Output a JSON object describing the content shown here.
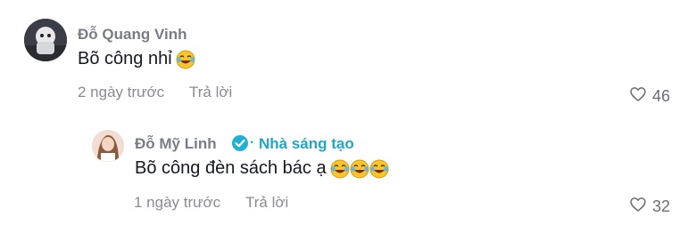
{
  "comments": [
    {
      "username": "Đỗ Quang Vinh",
      "text": "Bõ công nhỉ",
      "emoji_count": 1,
      "time": "2 ngày trước",
      "reply_label": "Trả lời",
      "likes": "46"
    },
    {
      "username": "Đỗ Mỹ Linh",
      "badge": "Nhà sáng tạo",
      "text": "Bõ công đèn sách bác ạ",
      "emoji_count": 3,
      "time": "1 ngày trước",
      "reply_label": "Trả lời",
      "likes": "32"
    }
  ],
  "icons": {
    "avatar": "user-avatar",
    "verified": "verified-check-icon",
    "emoji": "laughing-tears-emoji",
    "like": "heart-outline-icon"
  },
  "colors": {
    "username": "#7a7d85",
    "creator_badge": "#1fa7c9",
    "text": "#161823",
    "meta": "#8a8b91"
  }
}
